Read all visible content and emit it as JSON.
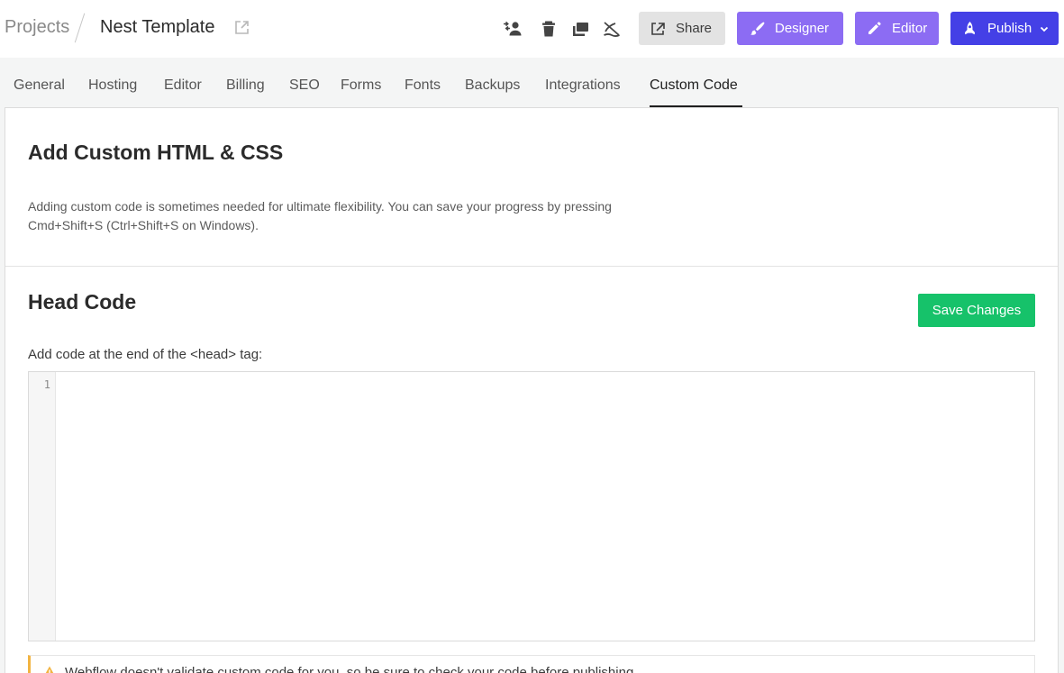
{
  "header": {
    "breadcrumb_root": "Projects",
    "project_name": "Nest Template",
    "icons": [
      "external-link-icon",
      "transfer-user-icon",
      "trash-icon",
      "duplicate-icon",
      "unpublish-icon"
    ],
    "buttons": {
      "share": "Share",
      "designer": "Designer",
      "editor": "Editor",
      "publish": "Publish"
    }
  },
  "tabs": [
    {
      "label": "General"
    },
    {
      "label": "Hosting"
    },
    {
      "label": "Editor"
    },
    {
      "label": "Billing"
    },
    {
      "label": "SEO"
    },
    {
      "label": "Forms"
    },
    {
      "label": "Fonts"
    },
    {
      "label": "Backups"
    },
    {
      "label": "Integrations"
    },
    {
      "label": "Custom Code"
    }
  ],
  "active_tab": "Custom Code",
  "custom_code": {
    "title": "Add Custom HTML & CSS",
    "description": "Adding custom code is sometimes needed for ultimate flexibility. You can save your progress by pressing Cmd+Shift+S (Ctrl+Shift+S on Windows)."
  },
  "head_code": {
    "title": "Head Code",
    "save_label": "Save Changes",
    "field_label": "Add code at the end of the <head> tag:",
    "line_number": "1",
    "warning": "Webflow doesn't validate custom code for you, so be sure to check your code before publishing."
  },
  "colors": {
    "designer": "#8c6cf3",
    "editor": "#8c6cf3",
    "publish": "#4440e6",
    "save": "#16c26a",
    "warning_accent": "#f2b441"
  }
}
